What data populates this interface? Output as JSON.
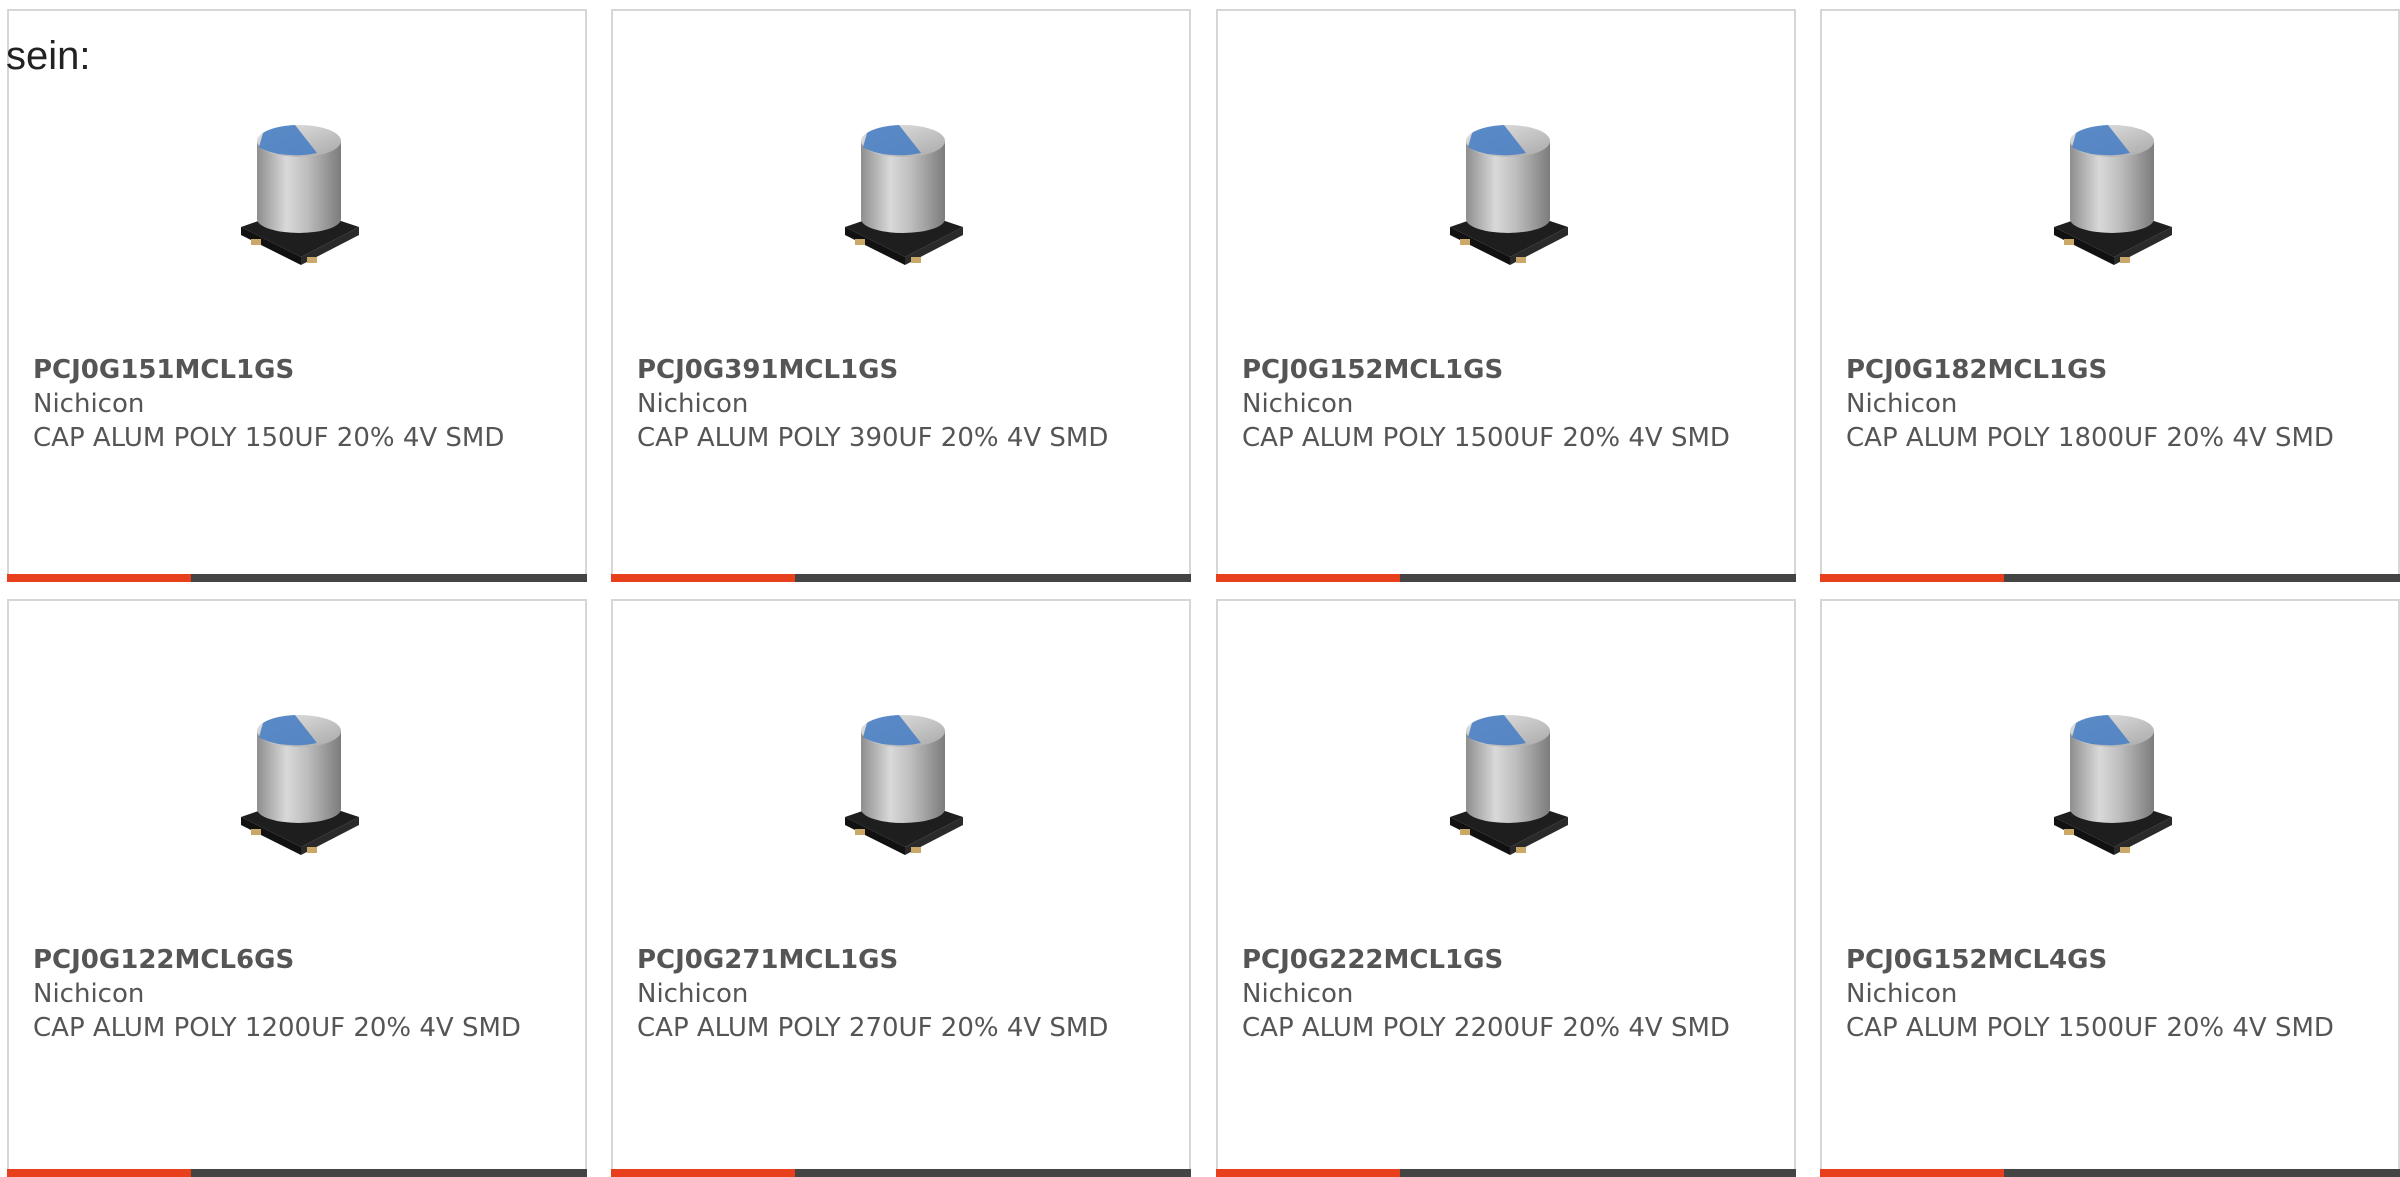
{
  "heading": "sein:",
  "colors": {
    "accent": "#e8401c",
    "bar": "#444444",
    "text": "#555555"
  },
  "products": [
    {
      "part_number": "PCJ0G151MCL1GS",
      "manufacturer": "Nichicon",
      "description": "CAP ALUM POLY 150UF 20% 4V SMD",
      "image": "capacitor-icon"
    },
    {
      "part_number": "PCJ0G391MCL1GS",
      "manufacturer": "Nichicon",
      "description": "CAP ALUM POLY 390UF 20% 4V SMD",
      "image": "capacitor-icon"
    },
    {
      "part_number": "PCJ0G152MCL1GS",
      "manufacturer": "Nichicon",
      "description": "CAP ALUM POLY 1500UF 20% 4V SMD",
      "image": "capacitor-icon"
    },
    {
      "part_number": "PCJ0G182MCL1GS",
      "manufacturer": "Nichicon",
      "description": "CAP ALUM POLY 1800UF 20% 4V SMD",
      "image": "capacitor-icon"
    },
    {
      "part_number": "PCJ0G122MCL6GS",
      "manufacturer": "Nichicon",
      "description": "CAP ALUM POLY 1200UF 20% 4V SMD",
      "image": "capacitor-icon"
    },
    {
      "part_number": "PCJ0G271MCL1GS",
      "manufacturer": "Nichicon",
      "description": "CAP ALUM POLY 270UF 20% 4V SMD",
      "image": "capacitor-icon"
    },
    {
      "part_number": "PCJ0G222MCL1GS",
      "manufacturer": "Nichicon",
      "description": "CAP ALUM POLY 2200UF 20% 4V SMD",
      "image": "capacitor-icon"
    },
    {
      "part_number": "PCJ0G152MCL4GS",
      "manufacturer": "Nichicon",
      "description": "CAP ALUM POLY 1500UF 20% 4V SMD",
      "image": "capacitor-icon"
    }
  ]
}
